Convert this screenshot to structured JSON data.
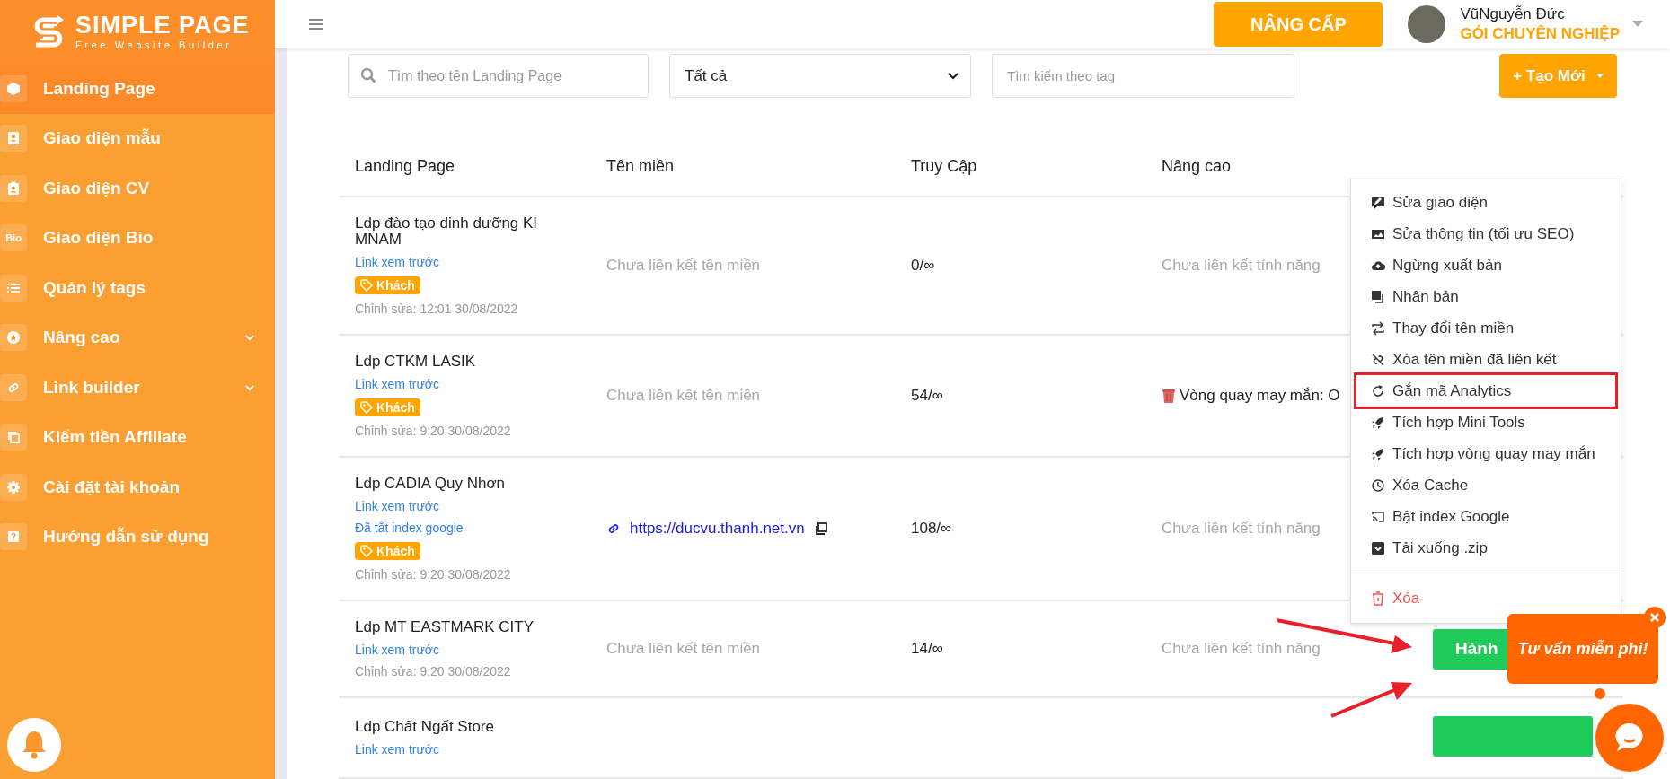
{
  "sidebar": {
    "logo": {
      "title": "SIMPLE PAGE",
      "subtitle": "Free Website Builder"
    },
    "items": [
      {
        "label": "Landing Page",
        "selected": true,
        "expandable": false
      },
      {
        "label": "Giao diện mẫu",
        "selected": false,
        "expandable": false
      },
      {
        "label": "Giao diện CV",
        "selected": false,
        "expandable": false
      },
      {
        "label": "Giao diện Bio",
        "selected": false,
        "expandable": false,
        "icon_text": "Bio"
      },
      {
        "label": "Quản lý tags",
        "selected": false,
        "expandable": false
      },
      {
        "label": "Nâng cao",
        "selected": false,
        "expandable": true
      },
      {
        "label": "Link builder",
        "selected": false,
        "expandable": true
      },
      {
        "label": "Kiếm tiền Affiliate",
        "selected": false,
        "expandable": false
      },
      {
        "label": "Cài đặt tài khoản",
        "selected": false,
        "expandable": false
      },
      {
        "label": "Hướng dẫn sử dụng",
        "selected": false,
        "expandable": false
      }
    ]
  },
  "topbar": {
    "upgrade_button": "NÂNG CẤP",
    "user": {
      "name": "VũNguyễn Đức",
      "plan": "GÓI CHUYÊN NGHIỆP"
    }
  },
  "filters": {
    "search": {
      "placeholder": "Tìm theo tên Landing Page"
    },
    "status_select": {
      "value": "Tất cả"
    },
    "tag_search": {
      "placeholder": "Tìm kiếm theo tag"
    },
    "create_button": "+ Tạo Mới"
  },
  "table": {
    "columns": [
      "Landing Page",
      "Tên miền",
      "Truy Cập",
      "Nâng cao"
    ],
    "rows": [
      {
        "name": "Ldp đào tạo dinh dưỡng KIMNAM",
        "preview_link": "Link xem trước",
        "tag": "Khách",
        "edited": "Chỉnh sửa: 12:01 30/08/2022",
        "domain": {
          "kind": "none",
          "text": "Chưa liên kết tên miền"
        },
        "visits": "0/∞",
        "advanced": {
          "kind": "none",
          "text": "Chưa liên kết tính năng"
        }
      },
      {
        "name": "Ldp CTKM LASIK",
        "preview_link": "Link xem trước",
        "tag": "Khách",
        "edited": "Chỉnh sửa: 9:20 30/08/2022",
        "domain": {
          "kind": "none",
          "text": "Chưa liên kết tên miền"
        },
        "visits": "54/∞",
        "advanced": {
          "kind": "feature",
          "text": "Vòng quay may mắn: O"
        }
      },
      {
        "name": "Ldp CADIA Quy Nhơn",
        "preview_link": "Link xem trước",
        "index_note": "Đã tắt index google",
        "tag": "Khách",
        "edited": "Chỉnh sửa: 9:20 30/08/2022",
        "domain": {
          "kind": "url",
          "text": "https://ducvu.thanh.net.vn"
        },
        "visits": "108/∞",
        "advanced": {
          "kind": "none",
          "text": "Chưa liên kết tính năng"
        }
      },
      {
        "name": "Ldp MT EASTMARK CITY",
        "preview_link": "Link xem trước",
        "edited": "Chỉnh sửa: 9:20 30/08/2022",
        "domain": {
          "kind": "none",
          "text": "Chưa liên kết tên miền"
        },
        "visits": "14/∞",
        "advanced": {
          "kind": "none",
          "text": "Chưa liên kết tính năng"
        },
        "action": "Hành"
      },
      {
        "name": "Ldp Chất Ngất Store",
        "preview_link": "Link xem trước"
      }
    ]
  },
  "action_menu": {
    "items": [
      {
        "label": "Sửa giao diện",
        "kind": "normal",
        "highlighted": false
      },
      {
        "label": "Sửa thông tin (tối ưu SEO)",
        "kind": "normal",
        "highlighted": false
      },
      {
        "label": "Ngừng xuất bản",
        "kind": "normal",
        "highlighted": false
      },
      {
        "label": "Nhân bản",
        "kind": "normal",
        "highlighted": false
      },
      {
        "label": "Thay đổi tên miền",
        "kind": "normal",
        "highlighted": false
      },
      {
        "label": "Xóa tên miền đã liên kết",
        "kind": "normal",
        "highlighted": false
      },
      {
        "label": "Gắn mã Analytics",
        "kind": "normal",
        "highlighted": true
      },
      {
        "label": "Tích hợp Mini Tools",
        "kind": "normal",
        "highlighted": false
      },
      {
        "label": "Tích hợp vòng quay may mắn",
        "kind": "normal",
        "highlighted": false
      },
      {
        "label": "Xóa Cache",
        "kind": "normal",
        "highlighted": false
      },
      {
        "label": "Bật index Google",
        "kind": "normal",
        "highlighted": false
      },
      {
        "label": "Tải xuống .zip",
        "kind": "normal",
        "highlighted": false
      },
      {
        "label": "Xóa",
        "kind": "danger",
        "highlighted": false
      }
    ]
  },
  "chat_widget": {
    "bubble": "Tư vấn miễn phí!"
  }
}
